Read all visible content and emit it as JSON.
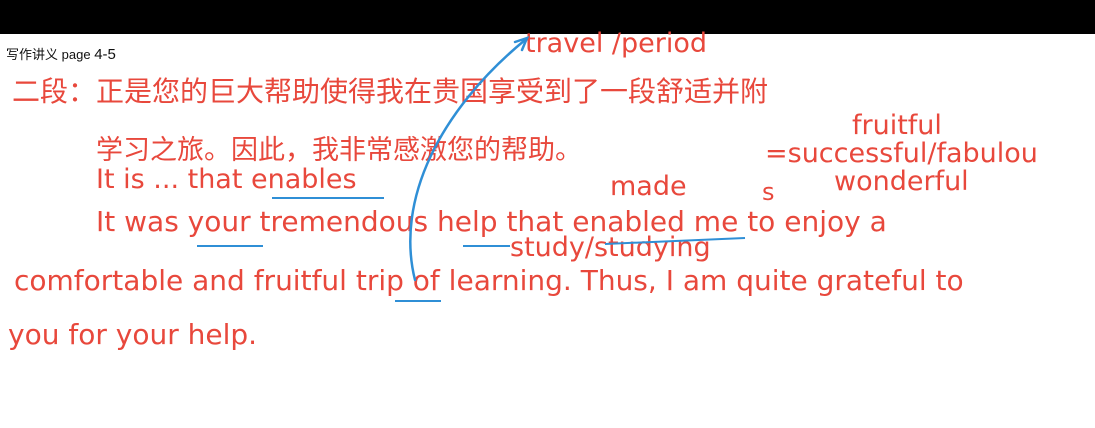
{
  "header": {
    "label": "写作讲义",
    "page_label": "page",
    "page_number": "4-5"
  },
  "body": {
    "line1": "二段：正是您的巨大帮助使得我在贵国享受到了一段舒适并附",
    "line2": "学习之旅。因此，我非常感激您的帮助。",
    "line3": "It is ... that enables",
    "line4": "It was your tremendous help that enabled me to enjoy a",
    "line5": "comfortable and fruitful trip of learning. Thus, I am quite grateful to",
    "line6": "you for your help."
  },
  "annotations": {
    "travel": "travel /period",
    "fruitful": "fruitful",
    "synonyms": "=successful/fabulou",
    "s_char": "s",
    "wonderful": "wonderful",
    "made": "made",
    "study": "study/studying"
  },
  "colors": {
    "text_red": "#e8483c",
    "ink_blue": "#2f8fd6",
    "topbar": "#000000"
  }
}
